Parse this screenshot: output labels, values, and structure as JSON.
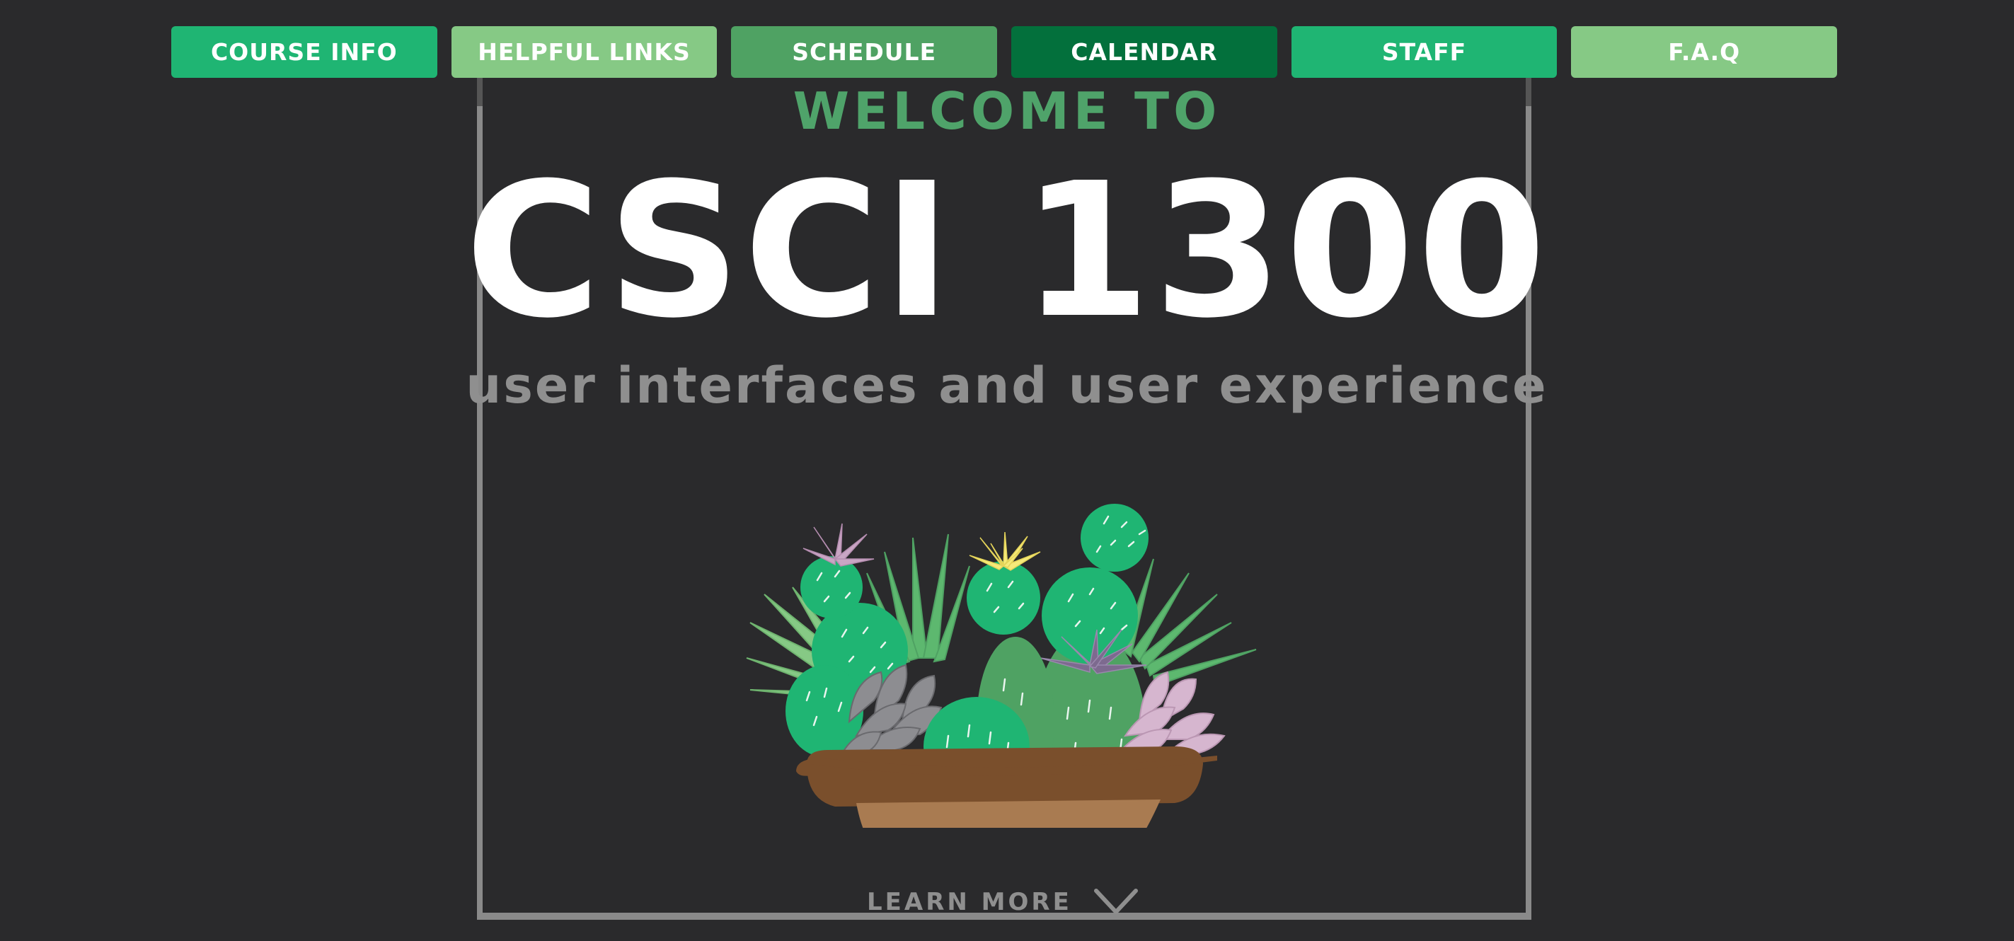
{
  "nav": {
    "items": [
      {
        "label": "COURSE INFO",
        "color": "#1fb573"
      },
      {
        "label": "HELPFUL LINKS",
        "color": "#86c985"
      },
      {
        "label": "SCHEDULE",
        "color": "#4fa263"
      },
      {
        "label": "CALENDAR",
        "color": "#03703c"
      },
      {
        "label": "STAFF",
        "color": "#1fb573"
      },
      {
        "label": "F.A.Q",
        "color": "#86c985"
      }
    ]
  },
  "hero": {
    "welcome": "WELCOME TO",
    "title": "CSCI 1300",
    "subtitle": "user interfaces and user experience"
  },
  "illustration": {
    "name": "succulent-bowl-illustration"
  },
  "learn_more": {
    "label": "LEARN MORE",
    "icon": "chevron-down-icon"
  },
  "colors": {
    "background": "#2a2a2c",
    "accent_green": "#4fa36a",
    "frame": "#8a8a8a",
    "muted_text": "#8f8f8f"
  }
}
